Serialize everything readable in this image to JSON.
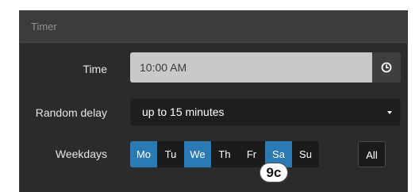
{
  "panel": {
    "title": "Timer"
  },
  "time": {
    "label": "Time",
    "value": "10:00 AM",
    "button_icon": "clock-icon"
  },
  "random_delay": {
    "label": "Random delay",
    "selected": "up to 15 minutes"
  },
  "weekdays": {
    "label": "Weekdays",
    "days": [
      {
        "label": "Mo",
        "active": true
      },
      {
        "label": "Tu",
        "active": false
      },
      {
        "label": "We",
        "active": true
      },
      {
        "label": "Th",
        "active": false
      },
      {
        "label": "Fr",
        "active": false
      },
      {
        "label": "Sa",
        "active": true
      },
      {
        "label": "Su",
        "active": false
      }
    ],
    "all_label": "All"
  },
  "badge": {
    "text": "9c"
  },
  "colors": {
    "active_day": "#2a7ab5",
    "panel_bg": "#2b2b2b",
    "header_bg": "#3c3c3c"
  }
}
